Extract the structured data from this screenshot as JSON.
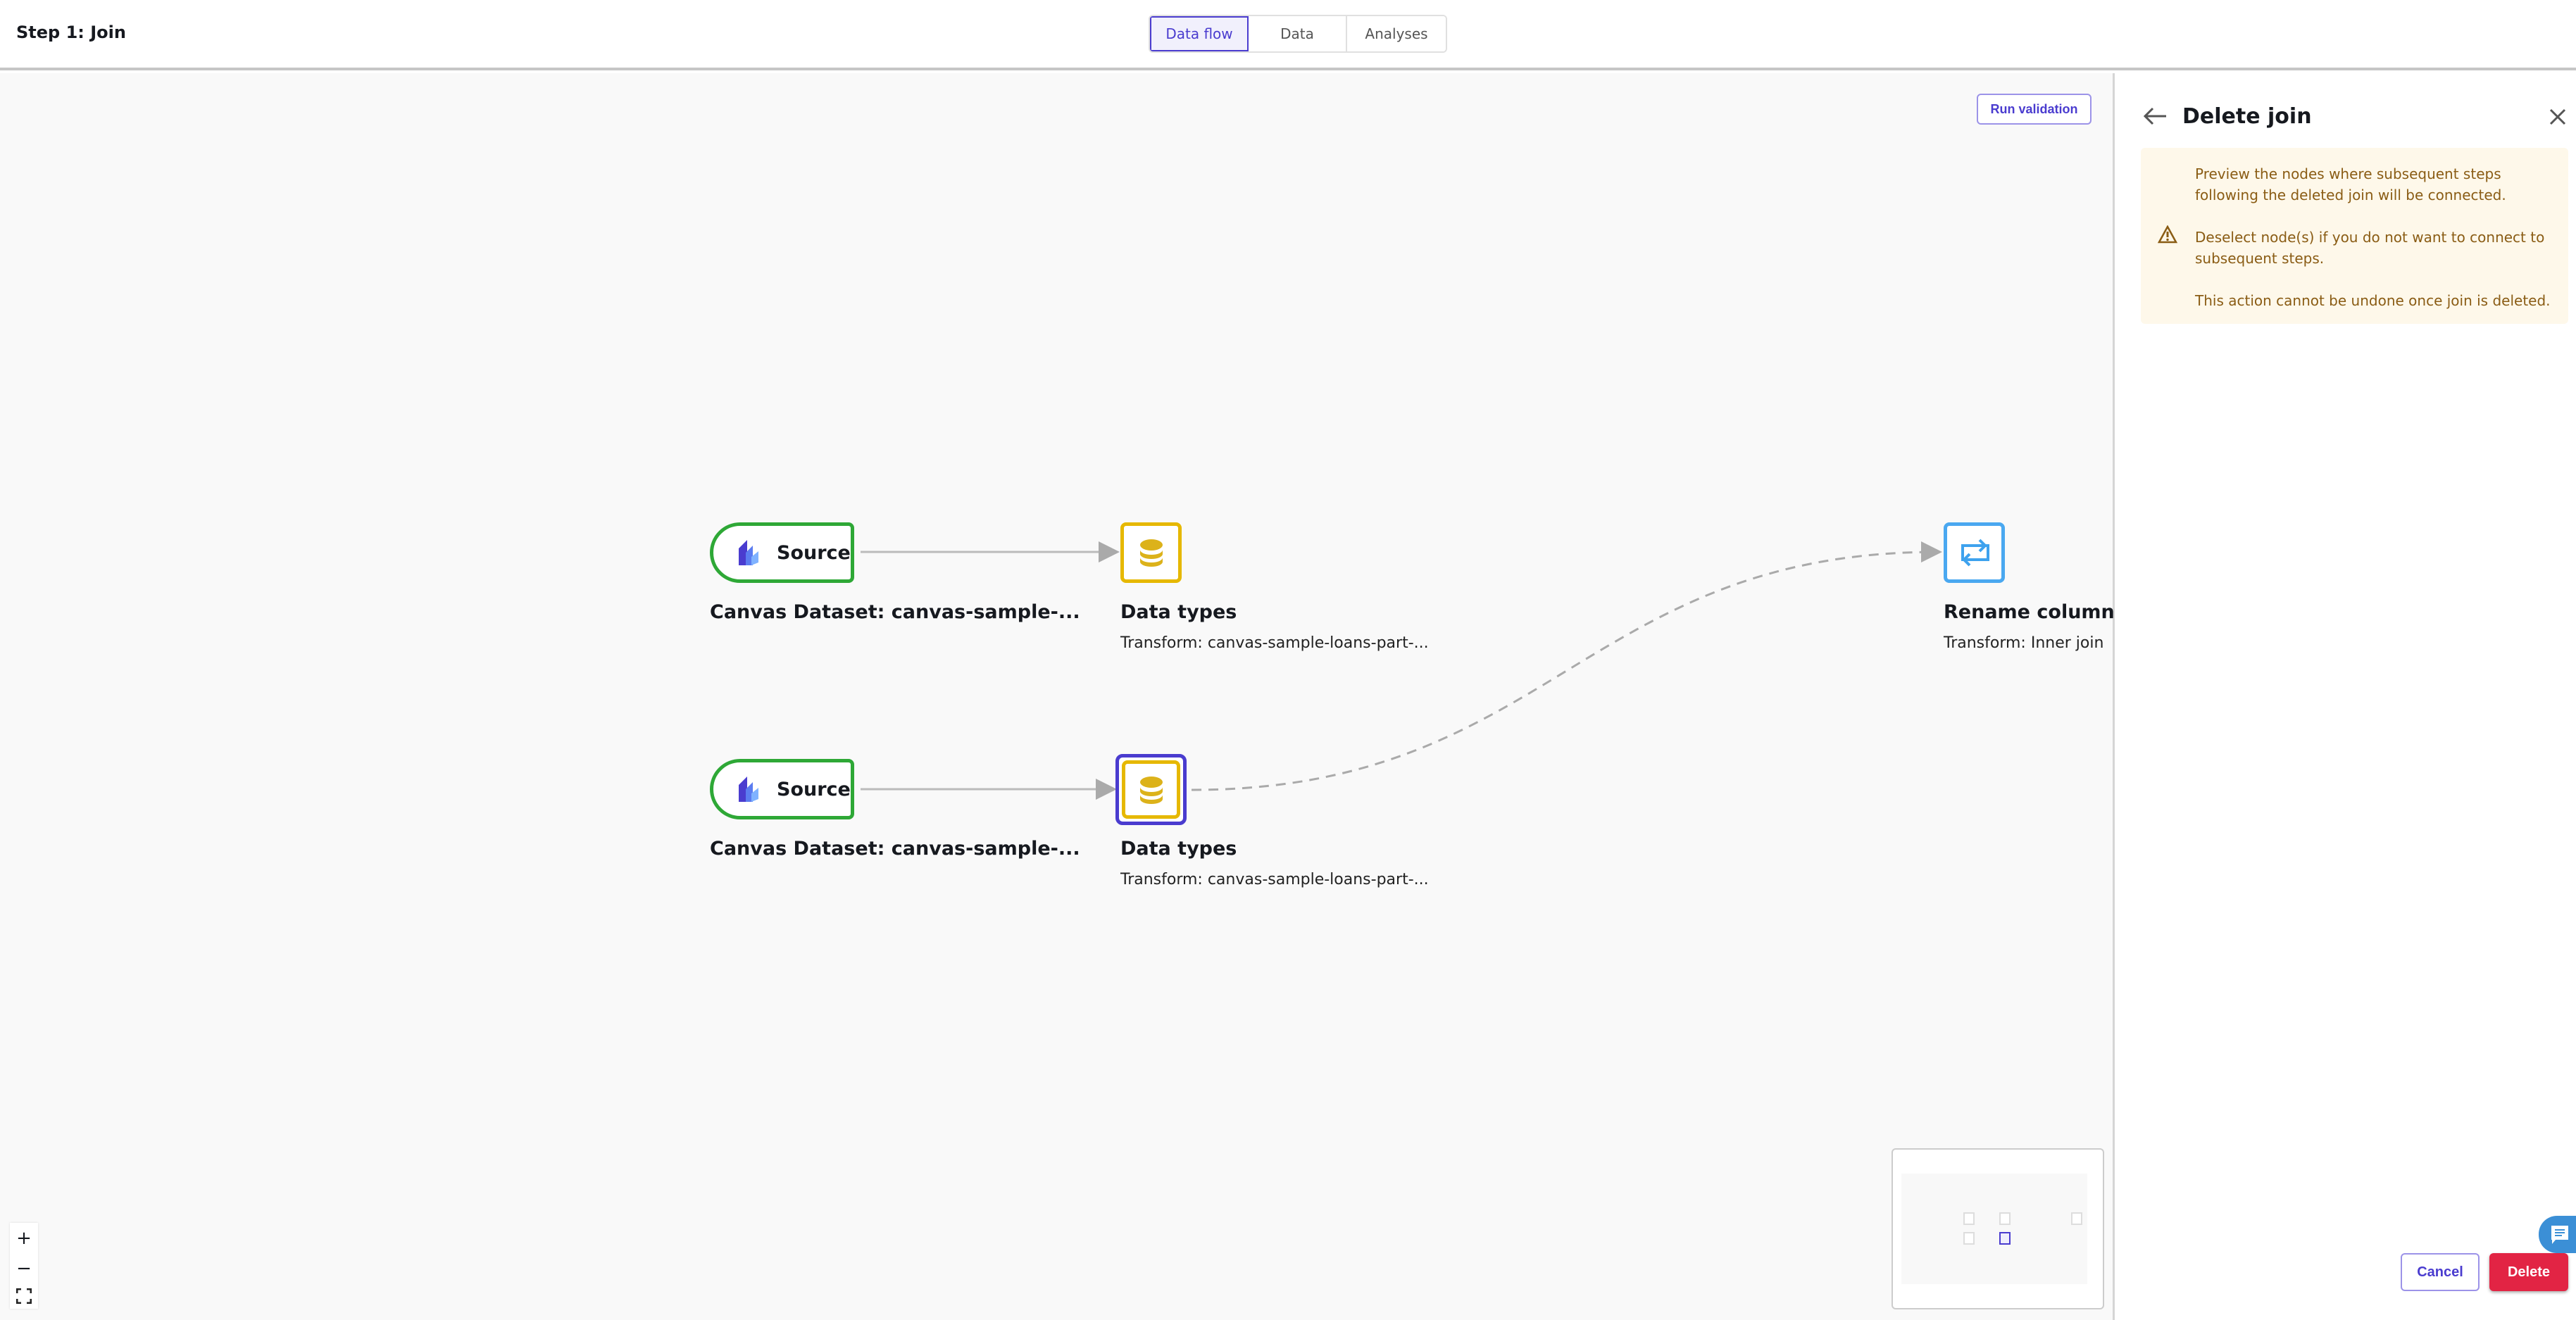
{
  "header": {
    "title": "Step 1: Join",
    "tabs": [
      {
        "label": "Data flow",
        "active": true
      },
      {
        "label": "Data"
      },
      {
        "label": "Analyses"
      }
    ]
  },
  "canvas": {
    "run_validation": "Run validation",
    "nodes": [
      {
        "type": "source",
        "label": "Source",
        "title": "Canvas Dataset: canvas-sample-..."
      },
      {
        "type": "transform",
        "title": "Data types",
        "subtitle": "Transform: canvas-sample-loans-part-...",
        "icon": "database-icon"
      },
      {
        "type": "source",
        "label": "Source",
        "title": "Canvas Dataset: canvas-sample-..."
      },
      {
        "type": "transform",
        "title": "Data types",
        "subtitle": "Transform: canvas-sample-loans-part-...",
        "icon": "database-icon",
        "selected": true
      },
      {
        "type": "transform",
        "title": "Rename column",
        "subtitle": "Transform: Inner join",
        "icon": "swap-arrows-icon"
      }
    ],
    "zoom_controls": {
      "zoom_in": "+",
      "zoom_out": "−"
    }
  },
  "panel": {
    "title": "Delete join",
    "warning": {
      "line1": "Preview the nodes where subsequent steps following the deleted join will be connected.",
      "line2": "Deselect node(s) if you do not want to connect to subsequent steps.",
      "line3": "This action cannot be undone once join is deleted."
    },
    "cancel": "Cancel",
    "delete": "Delete"
  },
  "colors": {
    "accent": "#4a3ccf",
    "source": "#2ea836",
    "datatypes": "#e6b800",
    "rename": "#4aa8f0",
    "delete": "#e22444",
    "warning_bg": "#fef8ea"
  }
}
